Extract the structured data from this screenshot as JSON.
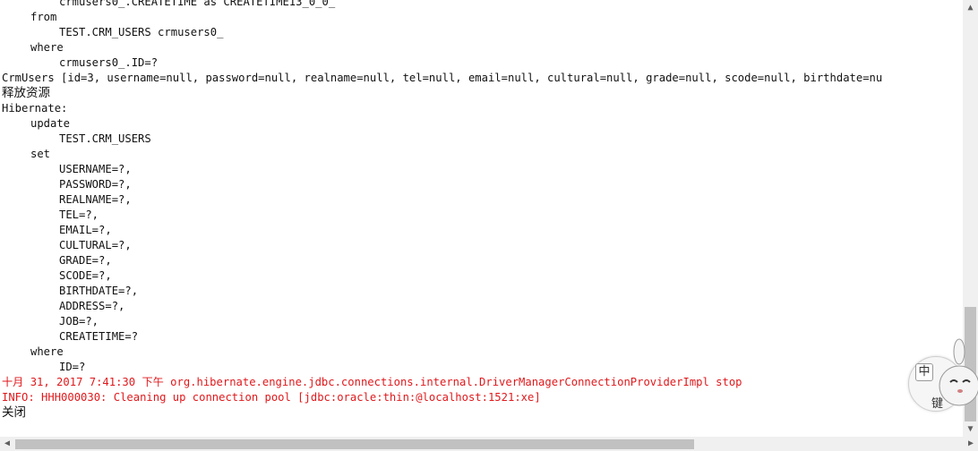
{
  "console": {
    "lines": [
      {
        "text": "crmusers0_.CREATETIME as CREATETIME13_0_0_",
        "indent": 2,
        "style": "normal"
      },
      {
        "text": "from",
        "indent": 1,
        "style": "normal"
      },
      {
        "text": "TEST.CRM_USERS crmusers0_",
        "indent": 2,
        "style": "normal"
      },
      {
        "text": "where",
        "indent": 1,
        "style": "normal"
      },
      {
        "text": "crmusers0_.ID=?",
        "indent": 2,
        "style": "normal"
      },
      {
        "text": "CrmUsers [id=3, username=null, password=null, realname=null, tel=null, email=null, cultural=null, grade=null, scode=null, birthdate=nu",
        "indent": 0,
        "style": "normal"
      },
      {
        "text": "释放资源",
        "indent": 0,
        "style": "cjk"
      },
      {
        "text": "Hibernate:",
        "indent": 0,
        "style": "normal"
      },
      {
        "text": "update",
        "indent": 1,
        "style": "normal"
      },
      {
        "text": "TEST.CRM_USERS",
        "indent": 2,
        "style": "normal"
      },
      {
        "text": "set",
        "indent": 1,
        "style": "normal"
      },
      {
        "text": "USERNAME=?,",
        "indent": 2,
        "style": "normal"
      },
      {
        "text": "PASSWORD=?,",
        "indent": 2,
        "style": "normal"
      },
      {
        "text": "REALNAME=?,",
        "indent": 2,
        "style": "normal"
      },
      {
        "text": "TEL=?,",
        "indent": 2,
        "style": "normal"
      },
      {
        "text": "EMAIL=?,",
        "indent": 2,
        "style": "normal"
      },
      {
        "text": "CULTURAL=?,",
        "indent": 2,
        "style": "normal"
      },
      {
        "text": "GRADE=?,",
        "indent": 2,
        "style": "normal"
      },
      {
        "text": "SCODE=?,",
        "indent": 2,
        "style": "normal"
      },
      {
        "text": "BIRTHDATE=?,",
        "indent": 2,
        "style": "normal"
      },
      {
        "text": "ADDRESS=?,",
        "indent": 2,
        "style": "normal"
      },
      {
        "text": "JOB=?,",
        "indent": 2,
        "style": "normal"
      },
      {
        "text": "CREATETIME=?",
        "indent": 2,
        "style": "normal"
      },
      {
        "text": "where",
        "indent": 1,
        "style": "normal"
      },
      {
        "text": "ID=?",
        "indent": 2,
        "style": "normal"
      },
      {
        "text": "十月 31, 2017 7:41:30 下午 org.hibernate.engine.jdbc.connections.internal.DriverManagerConnectionProviderImpl stop",
        "indent": 0,
        "style": "err"
      },
      {
        "text": "INFO: HHH000030: Cleaning up connection pool [jdbc:oracle:thin:@localhost:1521:xe]",
        "indent": 0,
        "style": "err"
      },
      {
        "text": "关闭",
        "indent": 0,
        "style": "cjk"
      }
    ]
  },
  "colors": {
    "error_text": "#e0191c",
    "normal_text": "#111111"
  },
  "scrollbars": {
    "vertical_up_icon": "▲",
    "vertical_down_icon": "▼",
    "horizontal_left_icon": "◀",
    "horizontal_right_icon": "▶"
  },
  "ime": {
    "mode_label": "中",
    "key_label": "键"
  }
}
